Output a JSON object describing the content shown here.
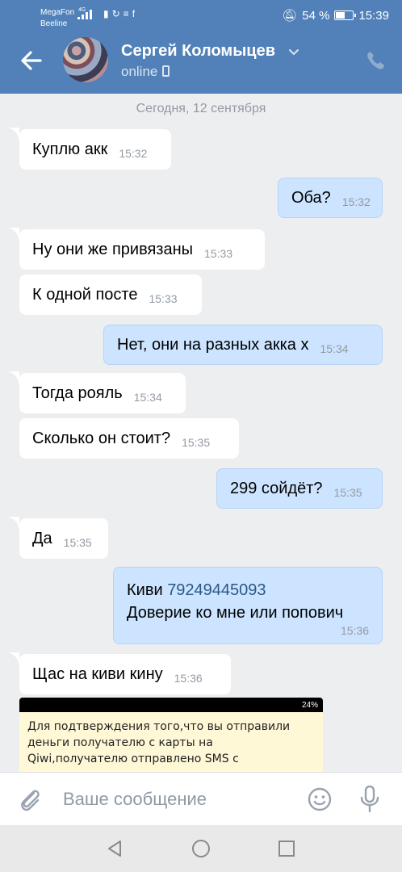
{
  "status_bar": {
    "carrier_1": "MegaFon",
    "carrier_1_net": "4G",
    "carrier_2": "Beeline",
    "battery": "54 %",
    "battery_level": 0.54,
    "time": "15:39"
  },
  "header": {
    "contact_name": "Сергей Коломыцев",
    "presence": "online",
    "accent": "#5181b8"
  },
  "chat": {
    "date_separator": "Сегодня, 12 сентября",
    "messages": [
      {
        "dir": "in",
        "text": "Куплю акк",
        "time": "15:32"
      },
      {
        "dir": "out",
        "text": "Оба?",
        "time": "15:32"
      },
      {
        "dir": "in",
        "text": "Ну они же привязаны",
        "time": "15:33"
      },
      {
        "dir": "in",
        "text": "К одной посте",
        "time": "15:33"
      },
      {
        "dir": "out",
        "text": "Нет, они на разных акка х",
        "time": "15:34"
      },
      {
        "dir": "in",
        "text": "Тогда рояль",
        "time": "15:34"
      },
      {
        "dir": "in",
        "text": "Сколько он стоит?",
        "time": "15:35"
      },
      {
        "dir": "out",
        "text": "299 сойдёт?",
        "time": "15:35"
      },
      {
        "dir": "in",
        "text": "Да",
        "time": "15:35"
      },
      {
        "dir": "out",
        "text_prefix": "Киви",
        "link": "79249445093",
        "text_line2": "Доверие ко мне или попович",
        "time": "15:36"
      },
      {
        "dir": "in",
        "text": "Щас на киви кину",
        "time": "15:36"
      }
    ],
    "attachment": {
      "status_text": "24%",
      "body": "Для подтверждения того,что вы отправили деньги получателю с карты на Qiwi,получателю отправлено SMS с одноразовым кодом"
    }
  },
  "composer": {
    "placeholder": "Ваше сообщение"
  }
}
